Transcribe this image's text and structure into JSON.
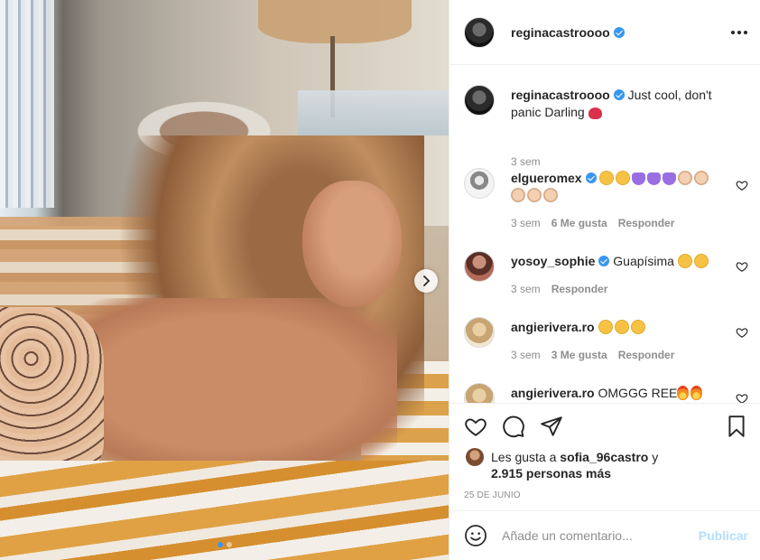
{
  "post": {
    "username": "reginacastroooo",
    "verified": true,
    "caption": "Just cool, don't panic Darling",
    "caption_time": "3 sem",
    "photo_pager": {
      "current": 1,
      "total": 2
    }
  },
  "comments": [
    {
      "username": "elgueromex",
      "verified": true,
      "text": "",
      "emojis": [
        "heart-eyes",
        "heart-eyes",
        "purple-heart",
        "purple-heart",
        "purple-heart",
        "clap",
        "clap",
        "clap",
        "clap",
        "clap"
      ],
      "time": "3 sem",
      "likes": "6 Me gusta",
      "reply": "Responder"
    },
    {
      "username": "yosoy_sophie",
      "verified": true,
      "text": "Guapísima",
      "emojis": [
        "heart-eyes",
        "heart-eyes"
      ],
      "time": "3 sem",
      "likes": "",
      "reply": "Responder"
    },
    {
      "username": "angierivera.ro",
      "verified": false,
      "text": "",
      "emojis": [
        "heart-eyes",
        "heart-eyes",
        "heart-eyes"
      ],
      "time": "3 sem",
      "likes": "3 Me gusta",
      "reply": "Responder"
    },
    {
      "username": "angierivera.ro",
      "verified": false,
      "text": "OMGGG REE",
      "emojis": [
        "fire",
        "fire"
      ],
      "time": "",
      "likes": "",
      "reply": ""
    }
  ],
  "likes_summary": {
    "prefix": "Les gusta a",
    "user": "sofia_96castro",
    "joiner": "y",
    "others": "2.915 personas más"
  },
  "date": "25 DE JUNIO",
  "add_comment": {
    "placeholder": "Añade un comentario...",
    "publish": "Publicar"
  },
  "colors": {
    "accent": "#3897f0",
    "publish_disabled": "#b2dffc",
    "muted": "#8e8e8e",
    "text": "#262626"
  }
}
